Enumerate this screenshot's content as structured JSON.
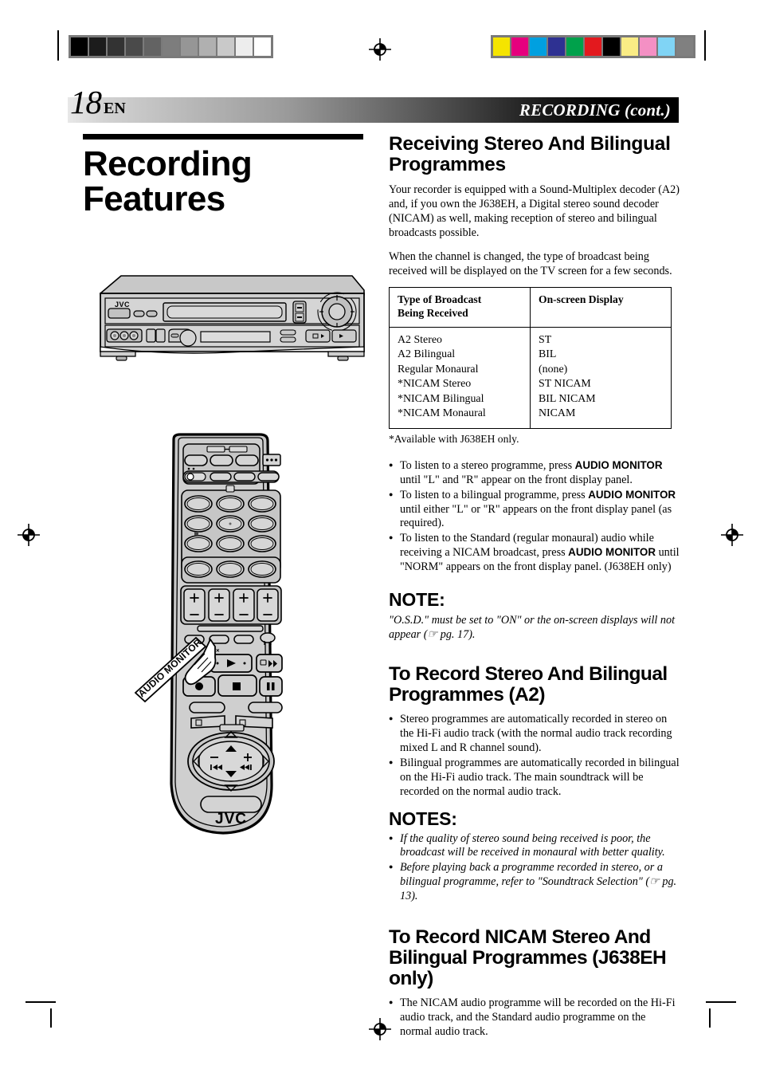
{
  "header": {
    "page_number": "18",
    "language_code": "EN",
    "section_title": "RECORDING (cont.)"
  },
  "left": {
    "doc_title_line1": "Recording",
    "doc_title_line2": "Features",
    "vcr_brand": "JVC",
    "remote_brand": "JVC",
    "callout_label": "AUDIO MONITOR"
  },
  "right": {
    "section1": {
      "heading": "Receiving Stereo And Bilingual Programmes",
      "paragraphs": [
        "Your recorder is equipped with a Sound-Multiplex decoder (A2) and, if you own the J638EH, a Digital stereo sound decoder (NICAM) as well, making reception of stereo and bilingual broadcasts possible.",
        "When the channel is changed, the type of broadcast being received will be displayed on the TV screen for a few seconds."
      ],
      "table": {
        "headers": [
          "Type of Broadcast Being Received",
          "On-screen Display"
        ],
        "header_col1_line1": "Type of Broadcast",
        "header_col1_line2": "Being Received",
        "rows": [
          [
            "A2 Stereo",
            "ST"
          ],
          [
            "A2 Bilingual",
            "BIL"
          ],
          [
            "Regular Monaural",
            "(none)"
          ],
          [
            "*NICAM Stereo",
            "ST NICAM"
          ],
          [
            "*NICAM Bilingual",
            "BIL NICAM"
          ],
          [
            "*NICAM Monaural",
            "NICAM"
          ]
        ]
      },
      "footnote": "*Available with J638EH only.",
      "bullets": [
        {
          "pre": "To listen to a stereo programme, press ",
          "bold": "AUDIO MONITOR",
          "post": " until \"L\" and \"R\" appear on the front display panel."
        },
        {
          "pre": "To listen to a bilingual programme, press ",
          "bold": "AUDIO MONITOR",
          "post": " until either \"L\" or \"R\" appears on the front display panel (as required)."
        },
        {
          "pre": "To listen to the Standard (regular monaural) audio while receiving a NICAM broadcast, press ",
          "bold": "AUDIO MONITOR",
          "post": " until \"NORM\" appears on the front display panel. (J638EH only)"
        }
      ],
      "note_heading": "NOTE:",
      "note_text": "\"O.S.D.\" must be set to \"ON\" or the on-screen displays will not appear (☞ pg. 17)."
    },
    "section2": {
      "heading": "To Record Stereo And Bilingual Programmes (A2)",
      "bullets": [
        "Stereo programmes are automatically recorded in stereo on the Hi-Fi audio track (with the normal audio track recording mixed L and R channel sound).",
        "Bilingual programmes are automatically recorded in bilingual on the Hi-Fi audio track. The main soundtrack will be recorded on the normal audio track."
      ],
      "notes_heading": "NOTES:",
      "notes": [
        "If the quality of stereo sound being received is poor, the broadcast will be received in monaural with better quality.",
        "Before playing back a programme recorded in stereo, or a bilingual programme, refer to \"Soundtrack Selection\" (☞ pg. 13)."
      ]
    },
    "section3": {
      "heading": "To Record NICAM Stereo And Bilingual Programmes (J638EH only)",
      "bullets": [
        "The NICAM audio programme will be recorded on the Hi-Fi audio track, and the Standard audio programme on the normal audio track."
      ]
    }
  },
  "calibration": {
    "grayscale_swatches": [
      "#000000",
      "#1c1c1c",
      "#333333",
      "#4a4a4a",
      "#636363",
      "#7d7d7d",
      "#969696",
      "#b0b0b0",
      "#c9c9c9",
      "#ededed",
      "#ffffff"
    ],
    "color_swatches": [
      "#f5e400",
      "#e6007e",
      "#00a0e0",
      "#2e3192",
      "#00a14b",
      "#e3191e",
      "#000000",
      "#faec85",
      "#f490c4",
      "#80d4f5",
      "#808080"
    ]
  }
}
